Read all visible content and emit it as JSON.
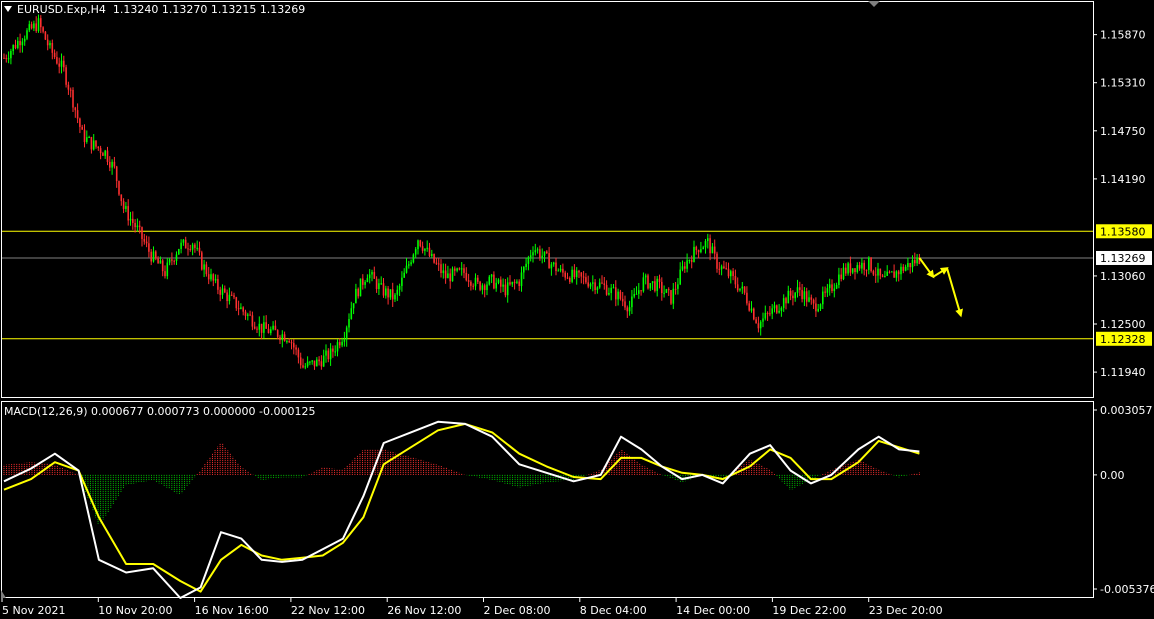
{
  "header": {
    "symbol": "EURUSD.Exp,H4",
    "ohlc": "1.13240 1.13270 1.13215 1.13269"
  },
  "macd_header": {
    "label": "MACD(12,26,9) 0.000677 0.000773 0.000000 -0.000125"
  },
  "colors": {
    "background": "#000000",
    "bull_candle": "#00ff00",
    "bear_candle": "#ff3030",
    "level_line": "#ffff00",
    "current_price_line": "#808080",
    "macd_line": "#ffffff",
    "signal_line": "#ffff00",
    "hist_pos": "#ff3030",
    "hist_neg": "#00c000",
    "arrow": "#ffff00"
  },
  "chart_data": [
    {
      "type": "candlestick",
      "symbol": "EURUSD",
      "timeframe": "H4",
      "ylim": [
        1.1165,
        1.1625
      ],
      "price_ticks": [
        "1.15870",
        "1.15310",
        "1.14750",
        "1.14190",
        "1.13580",
        "1.13269",
        "1.13060",
        "1.12500",
        "1.12328",
        "1.11940"
      ],
      "levels": [
        {
          "value": 1.1358,
          "label": "1.13580"
        },
        {
          "value": 1.12328,
          "label": "1.12328"
        }
      ],
      "current_price": {
        "value": 1.13269,
        "label": "1.13269"
      },
      "time_labels": [
        "5 Nov 2021",
        "10 Nov 20:00",
        "16 Nov 16:00",
        "22 Nov 12:00",
        "26 Nov 12:00",
        "2 Dec 08:00",
        "8 Dec 04:00",
        "14 Dec 00:00",
        "19 Dec 22:00",
        "23 Dec 20:00"
      ],
      "close_path": [
        [
          0,
          1.156
        ],
        [
          8,
          1.1585
        ],
        [
          15,
          1.16
        ],
        [
          20,
          1.157
        ],
        [
          26,
          1.1545
        ],
        [
          30,
          1.151
        ],
        [
          34,
          1.147
        ],
        [
          38,
          1.146
        ],
        [
          44,
          1.145
        ],
        [
          48,
          1.143
        ],
        [
          52,
          1.1385
        ],
        [
          58,
          1.136
        ],
        [
          64,
          1.133
        ],
        [
          70,
          1.131
        ],
        [
          76,
          1.134
        ],
        [
          82,
          1.1345
        ],
        [
          86,
          1.132
        ],
        [
          92,
          1.1295
        ],
        [
          98,
          1.128
        ],
        [
          106,
          1.126
        ],
        [
          112,
          1.1245
        ],
        [
          118,
          1.124
        ],
        [
          124,
          1.1235
        ],
        [
          130,
          1.12
        ],
        [
          136,
          1.1205
        ],
        [
          142,
          1.1215
        ],
        [
          148,
          1.124
        ],
        [
          152,
          1.128
        ],
        [
          158,
          1.131
        ],
        [
          164,
          1.129
        ],
        [
          170,
          1.128
        ],
        [
          176,
          1.132
        ],
        [
          180,
          1.135
        ],
        [
          186,
          1.1325
        ],
        [
          192,
          1.1305
        ],
        [
          200,
          1.131
        ],
        [
          206,
          1.1295
        ],
        [
          212,
          1.13
        ],
        [
          218,
          1.129
        ],
        [
          224,
          1.13
        ],
        [
          230,
          1.134
        ],
        [
          236,
          1.1325
        ],
        [
          242,
          1.131
        ],
        [
          248,
          1.1305
        ],
        [
          254,
          1.13
        ],
        [
          260,
          1.1295
        ],
        [
          266,
          1.1285
        ],
        [
          272,
          1.127
        ],
        [
          278,
          1.13
        ],
        [
          284,
          1.1295
        ],
        [
          290,
          1.128
        ],
        [
          296,
          1.132
        ],
        [
          302,
          1.134
        ],
        [
          306,
          1.1345
        ],
        [
          310,
          1.132
        ],
        [
          316,
          1.1305
        ],
        [
          322,
          1.1285
        ],
        [
          328,
          1.125
        ],
        [
          334,
          1.1265
        ],
        [
          340,
          1.128
        ],
        [
          346,
          1.129
        ],
        [
          352,
          1.127
        ],
        [
          358,
          1.1285
        ],
        [
          364,
          1.131
        ],
        [
          370,
          1.1318
        ],
        [
          376,
          1.132
        ],
        [
          382,
          1.13
        ],
        [
          388,
          1.131
        ],
        [
          394,
          1.132
        ],
        [
          398,
          1.1326
        ]
      ],
      "forecast_path": [
        [
          398,
          1.1327
        ],
        [
          404,
          1.1305
        ],
        [
          410,
          1.1315
        ],
        [
          416,
          1.126
        ]
      ]
    },
    {
      "type": "line",
      "indicator": "MACD(12,26,9)",
      "ylim": [
        -0.005376,
        0.003057
      ],
      "tick_labels": [
        "0.003057",
        "0.00",
        "-0.005376"
      ],
      "series": [
        {
          "name": "MACD",
          "points": [
            [
              0,
              -0.0003
            ],
            [
              8,
              0.0003
            ],
            [
              15,
              0.001
            ],
            [
              22,
              0.0002
            ],
            [
              28,
              -0.004
            ],
            [
              36,
              -0.0046
            ],
            [
              44,
              -0.0044
            ],
            [
              52,
              -0.0058
            ],
            [
              58,
              -0.0053
            ],
            [
              64,
              -0.0027
            ],
            [
              70,
              -0.003
            ],
            [
              76,
              -0.004
            ],
            [
              82,
              -0.0041
            ],
            [
              88,
              -0.004
            ],
            [
              94,
              -0.0035
            ],
            [
              100,
              -0.003
            ],
            [
              106,
              -0.001
            ],
            [
              112,
              0.0015
            ],
            [
              120,
              0.002
            ],
            [
              128,
              0.0025
            ],
            [
              136,
              0.0024
            ],
            [
              144,
              0.0018
            ],
            [
              152,
              0.0005
            ],
            [
              160,
              0.0001
            ],
            [
              168,
              -0.0003
            ],
            [
              176,
              0.0
            ],
            [
              182,
              0.0018
            ],
            [
              188,
              0.0012
            ],
            [
              194,
              0.0004
            ],
            [
              200,
              -0.0002
            ],
            [
              206,
              0.0
            ],
            [
              212,
              -0.0004
            ],
            [
              220,
              0.001
            ],
            [
              226,
              0.0014
            ],
            [
              232,
              0.0002
            ],
            [
              238,
              -0.0004
            ],
            [
              244,
              0.0
            ],
            [
              252,
              0.0012
            ],
            [
              258,
              0.0018
            ],
            [
              264,
              0.0012
            ],
            [
              270,
              0.0011
            ]
          ]
        },
        {
          "name": "Signal",
          "points": [
            [
              0,
              -0.0007
            ],
            [
              8,
              -0.0002
            ],
            [
              15,
              0.0006
            ],
            [
              22,
              0.0002
            ],
            [
              28,
              -0.002
            ],
            [
              36,
              -0.0042
            ],
            [
              44,
              -0.0042
            ],
            [
              52,
              -0.005
            ],
            [
              58,
              -0.0055
            ],
            [
              64,
              -0.004
            ],
            [
              70,
              -0.0033
            ],
            [
              76,
              -0.0038
            ],
            [
              82,
              -0.004
            ],
            [
              88,
              -0.0039
            ],
            [
              94,
              -0.0038
            ],
            [
              100,
              -0.0032
            ],
            [
              106,
              -0.002
            ],
            [
              112,
              0.0005
            ],
            [
              120,
              0.0013
            ],
            [
              128,
              0.0021
            ],
            [
              136,
              0.0024
            ],
            [
              144,
              0.002
            ],
            [
              152,
              0.001
            ],
            [
              160,
              0.0004
            ],
            [
              168,
              -0.0001
            ],
            [
              176,
              -0.0002
            ],
            [
              182,
              0.0008
            ],
            [
              188,
              0.0008
            ],
            [
              194,
              0.0004
            ],
            [
              200,
              0.0001
            ],
            [
              206,
              0.0
            ],
            [
              212,
              -0.0002
            ],
            [
              220,
              0.0004
            ],
            [
              226,
              0.0012
            ],
            [
              232,
              0.0008
            ],
            [
              238,
              -0.0002
            ],
            [
              244,
              -0.0002
            ],
            [
              252,
              0.0006
            ],
            [
              258,
              0.0016
            ],
            [
              264,
              0.0013
            ],
            [
              270,
              0.001
            ]
          ]
        }
      ]
    }
  ]
}
